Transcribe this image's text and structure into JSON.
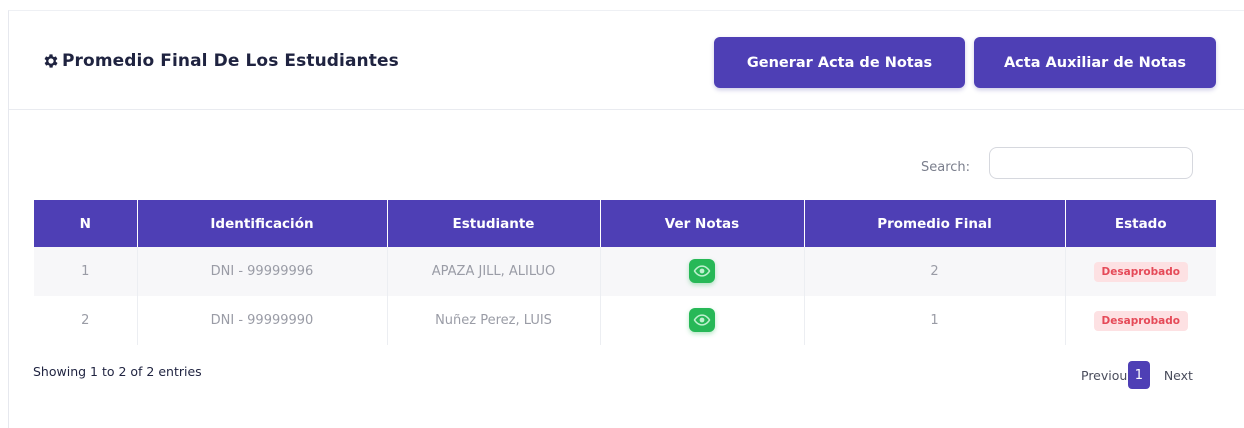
{
  "header": {
    "title": "Promedio Final De Los Estudiantes",
    "buttons": {
      "generar": "Generar Acta de Notas",
      "auxiliar": "Acta Auxiliar de Notas"
    }
  },
  "search": {
    "label": "Search:",
    "value": ""
  },
  "table": {
    "columns": [
      "N",
      "Identificación",
      "Estudiante",
      "Ver Notas",
      "Promedio Final",
      "Estado"
    ],
    "rows": [
      {
        "n": "1",
        "id": "DNI - 99999996",
        "estudiante": "APAZA JILL, ALILUO",
        "ver_icon": "eye-icon",
        "promedio": "2",
        "estado": "Desaprobado"
      },
      {
        "n": "2",
        "id": "DNI - 99999990",
        "estudiante": "Nuñez Perez, LUIS",
        "ver_icon": "eye-icon",
        "promedio": "1",
        "estado": "Desaprobado"
      }
    ]
  },
  "footer": {
    "info": "Showing 1 to 2 of 2 entries",
    "previous": "Previous",
    "page": "1",
    "next": "Next"
  },
  "colors": {
    "primary": "#4e3fb5",
    "success": "#27b857",
    "danger_bg": "#fde1e3",
    "danger_text": "#e54a58"
  }
}
